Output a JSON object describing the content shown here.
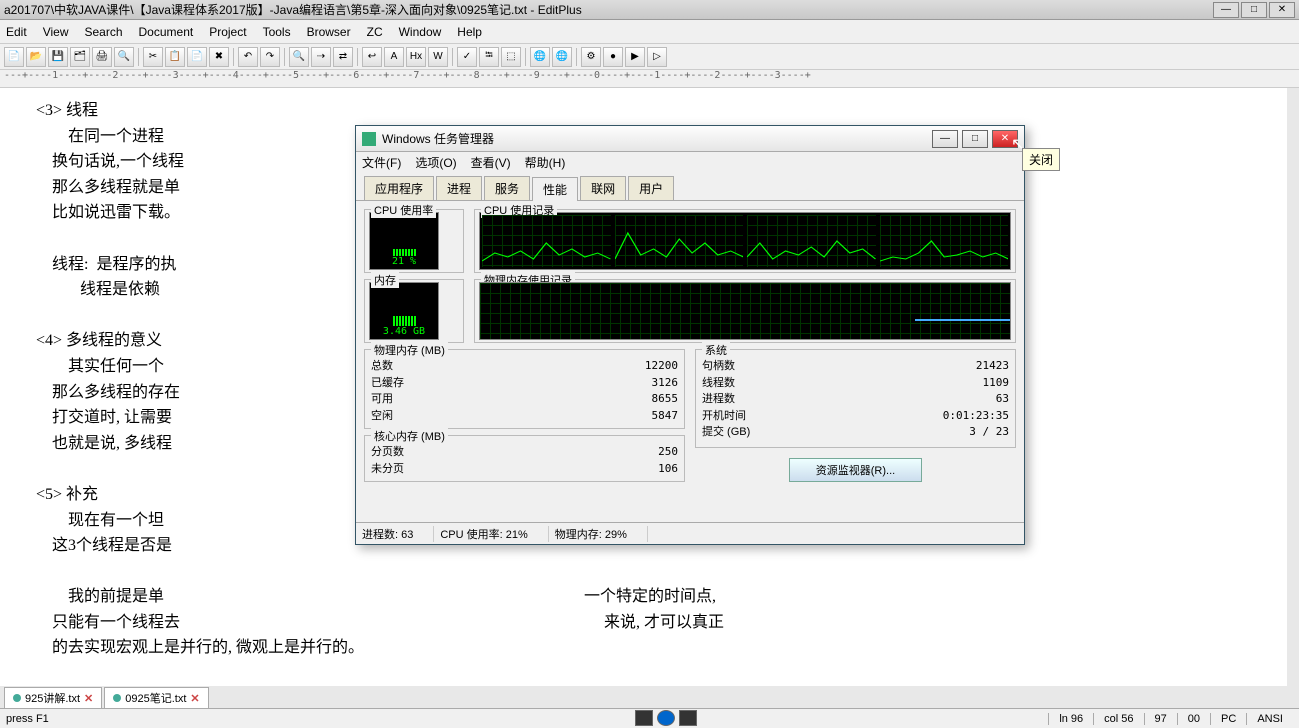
{
  "app_title": "a201707\\中软JAVA课件\\【Java课程体系2017版】-Java编程语言\\第5章-深入面向对象\\0925笔记.txt - EditPlus",
  "menubar": [
    "Edit",
    "View",
    "Search",
    "Document",
    "Project",
    "Tools",
    "Browser",
    "ZC",
    "Window",
    "Help"
  ],
  "toolbar_icons": [
    "new",
    "open",
    "save",
    "saveall",
    "print",
    "preview",
    "|",
    "cut",
    "copy",
    "paste",
    "delete",
    "|",
    "undo",
    "redo",
    "|",
    "find",
    "findnext",
    "replace",
    "|",
    "wrap",
    "font",
    "hex",
    "web",
    "|",
    "spell",
    "tab",
    "hexview",
    "|",
    "browser",
    "browser2",
    "|",
    "settings",
    "record",
    "play",
    "run"
  ],
  "ruler": "---+----1----+----2----+----3----+----4----+----5----+----6----+----7----+----8----+----9----+----0----+----1----+----2----+----3----+",
  "editor_lines": [
    "    <3> 线程",
    "            在同一个进程",
    "        换句话说,一个线程",
    "        那么多线程就是单",
    "        比如说迅雷下载。",
    "",
    "        线程:  是程序的执                                                                                                       它只能用于程序中。",
    "               线程是依赖",
    "",
    "    <4> 多线程的意义",
    "            其实任何一个                                                                                                         程序来执行,",
    "        那么多线程的存在                                                                                                         和I/O等资源",
    "        打交道时, 让需要                                                                                                          程编程的最终目的。",
    "        也就是说, 多线程                                                                                                         资源。",
    "",
    "    <5> 补充",
    "            现在有一个坦                                                                                                         多的子弹在飞, 问题是:",
    "        这3个线程是否是                                                                                                          ",
    "",
    "            我的前提是单                                                                                                         一个特定的时间点,",
    "        只能有一个线程去                                                                                                          来说, 才可以真正",
    "        的去实现宏观上是并行的, 微观上是并行的。"
  ],
  "tabs": [
    {
      "label": "925讲解.txt"
    },
    {
      "label": "0925笔记.txt"
    }
  ],
  "statusbar": {
    "hint": "press F1",
    "ln": "ln 96",
    "col": "col 56",
    "v1": "97",
    "v2": "00",
    "enc": "PC",
    "charset": "ANSI"
  },
  "taskmgr": {
    "title": "Windows 任务管理器",
    "close_tooltip": "关闭",
    "menu": [
      "文件(F)",
      "选项(O)",
      "查看(V)",
      "帮助(H)"
    ],
    "tabs": [
      "应用程序",
      "进程",
      "服务",
      "性能",
      "联网",
      "用户"
    ],
    "active_tab": "性能",
    "cpu_usage_label": "CPU 使用率",
    "cpu_history_label": "CPU 使用记录",
    "mem_label": "内存",
    "mem_history_label": "物理内存使用记录",
    "cpu_usage_value": "21 %",
    "mem_usage_value": "3.46 GB",
    "phys_mem": {
      "title": "物理内存 (MB)",
      "rows": [
        {
          "k": "总数",
          "v": "12200"
        },
        {
          "k": "已缓存",
          "v": "3126"
        },
        {
          "k": "可用",
          "v": "8655"
        },
        {
          "k": "空闲",
          "v": "5847"
        }
      ]
    },
    "kernel_mem": {
      "title": "核心内存 (MB)",
      "rows": [
        {
          "k": "分页数",
          "v": "250"
        },
        {
          "k": "未分页",
          "v": "106"
        }
      ]
    },
    "system": {
      "title": "系统",
      "rows": [
        {
          "k": "句柄数",
          "v": "21423"
        },
        {
          "k": "线程数",
          "v": "1109"
        },
        {
          "k": "进程数",
          "v": "63"
        },
        {
          "k": "开机时间",
          "v": "0:01:23:35"
        },
        {
          "k": "提交 (GB)",
          "v": "3 / 23"
        }
      ]
    },
    "resmon_btn": "资源监视器(R)...",
    "statusbar": {
      "processes": "进程数: 63",
      "cpu": "CPU 使用率: 21%",
      "mem": "物理内存: 29%"
    }
  }
}
